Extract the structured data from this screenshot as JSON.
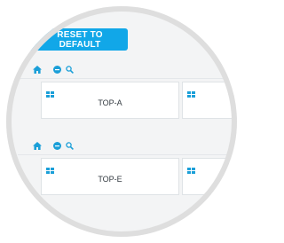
{
  "toolbar_top": {
    "reset_label": "RESET TO DEFAULT"
  },
  "groups": [
    {
      "panel_label": "TOP-A"
    },
    {
      "panel_label": "TOP-E"
    }
  ],
  "colors": {
    "accent": "#11a7e8",
    "icon": "#1a9fd8",
    "panel_border": "#dfe3e6",
    "ring": "#dedede"
  },
  "icons": {
    "home": "home-icon",
    "collapse": "minus-circle-icon",
    "zoom": "magnifier-icon",
    "layout": "grid-icon"
  }
}
